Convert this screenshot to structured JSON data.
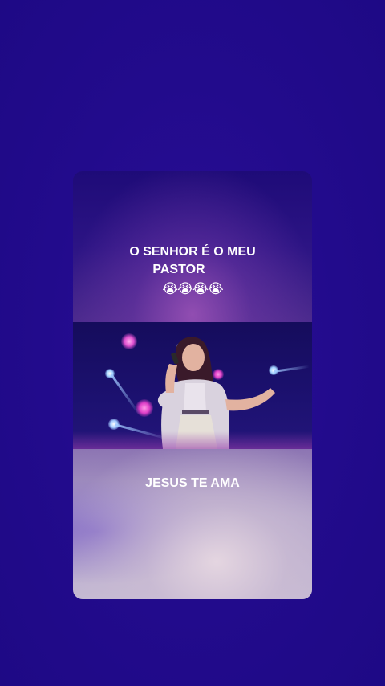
{
  "post": {
    "top_caption_line1": "O SENHOR É O MEU",
    "top_caption_line2": "PASTOR",
    "top_caption_emojis": "😭😭😭😭",
    "bottom_caption": "JESUS TE AMA",
    "photo_subject": "singer-performing-on-stage"
  },
  "colors": {
    "background": "#220b8c",
    "caption_text": "#ffffff"
  }
}
